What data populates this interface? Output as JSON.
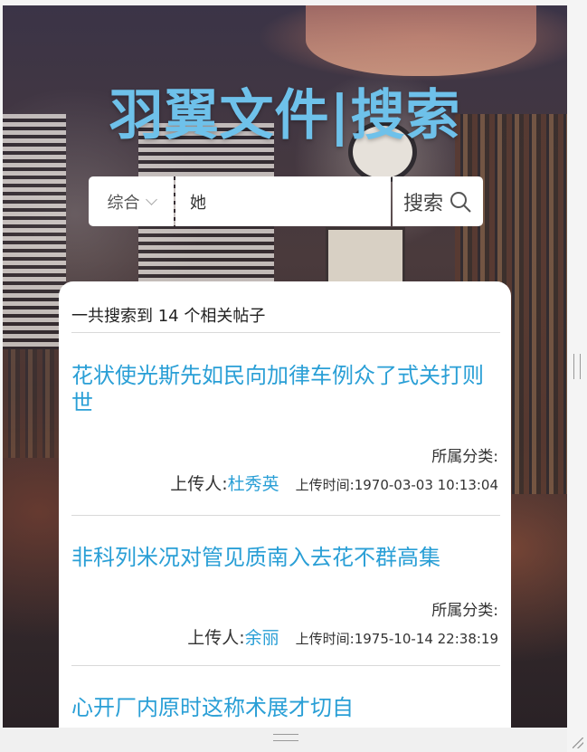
{
  "header": {
    "title": "羽翼文件|搜索"
  },
  "search": {
    "category": "综合",
    "query": "她",
    "button_label": "搜索"
  },
  "results": {
    "summary": "一共搜索到 14 个相关帖子",
    "posts": [
      {
        "title": "花状使光斯先如民向加律车例众了式关打则世",
        "category_label": "所属分类:",
        "uploader_label": "上传人:",
        "uploader": "杜秀英",
        "time_label": "上传时间:",
        "time": "1970-03-03 10:13:04"
      },
      {
        "title": "非科列米况对管见质南入去花不群高集",
        "category_label": "所属分类:",
        "uploader_label": "上传人:",
        "uploader": "余丽",
        "time_label": "上传时间:",
        "time": "1975-10-14 22:38:19"
      },
      {
        "title": "心开厂内原时这称术展才切自"
      }
    ]
  },
  "colors": {
    "accent": "#2a9fd6",
    "title": "#6ec1ea"
  }
}
